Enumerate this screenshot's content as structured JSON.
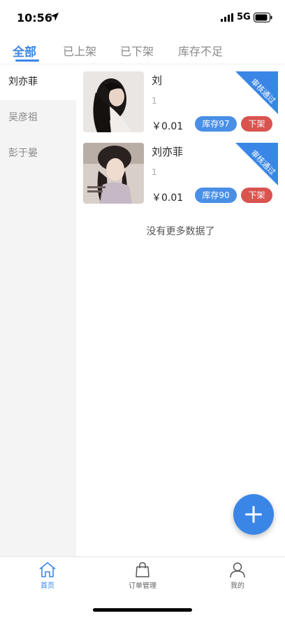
{
  "status_bar": {
    "time": "10:56",
    "network": "5G"
  },
  "tabs": [
    {
      "label": "全部"
    },
    {
      "label": "已上架"
    },
    {
      "label": "已下架"
    },
    {
      "label": "库存不足"
    }
  ],
  "sidebar": {
    "items": [
      {
        "label": "刘亦菲"
      },
      {
        "label": "吴彦祖"
      },
      {
        "label": "彭于晏"
      }
    ]
  },
  "products": [
    {
      "name": "刘",
      "subtitle": "1",
      "price": "￥0.01",
      "stock_label": "库存97",
      "action_label": "下架",
      "badge": "审核通过"
    },
    {
      "name": "刘亦菲",
      "subtitle": "1",
      "price": "￥0.01",
      "stock_label": "库存90",
      "action_label": "下架",
      "badge": "审核通过"
    }
  ],
  "list_footer": "没有更多数据了",
  "fab": {
    "icon": "plus-icon"
  },
  "bottom_nav": {
    "items": [
      {
        "label": "首页",
        "icon": "home-icon"
      },
      {
        "label": "订单管理",
        "icon": "shopping-bag-icon"
      },
      {
        "label": "我的",
        "icon": "user-icon"
      }
    ]
  },
  "colors": {
    "accent": "#3a86e6",
    "danger": "#d9534f",
    "sidebar_bg": "#f4f4f4"
  }
}
